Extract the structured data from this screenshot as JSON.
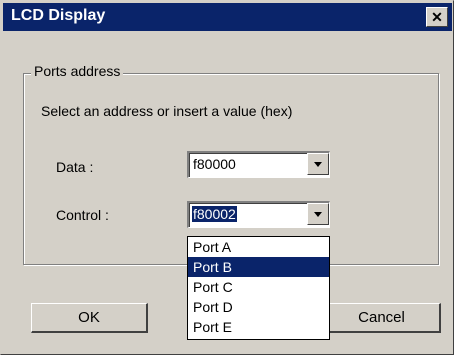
{
  "window": {
    "title": "LCD Display",
    "close_glyph": "✕"
  },
  "group": {
    "legend": "Ports address",
    "instruction": "Select an address or insert a value (hex)"
  },
  "data_field": {
    "label": "Data :",
    "value": "f80000"
  },
  "control_field": {
    "label": "Control :",
    "value": "f80002"
  },
  "dropdown": {
    "items": [
      "Port A",
      "Port B",
      "Port C",
      "Port D",
      "Port E"
    ],
    "highlighted_index": 1
  },
  "buttons": {
    "ok": "OK",
    "cancel": "Cancel"
  },
  "colors": {
    "face": "#d4d0c8",
    "title_bar": "#0a246a",
    "selection": "#0a246a"
  },
  "icons": {
    "close": "close-icon",
    "dropdown_arrow": "chevron-down-icon"
  }
}
